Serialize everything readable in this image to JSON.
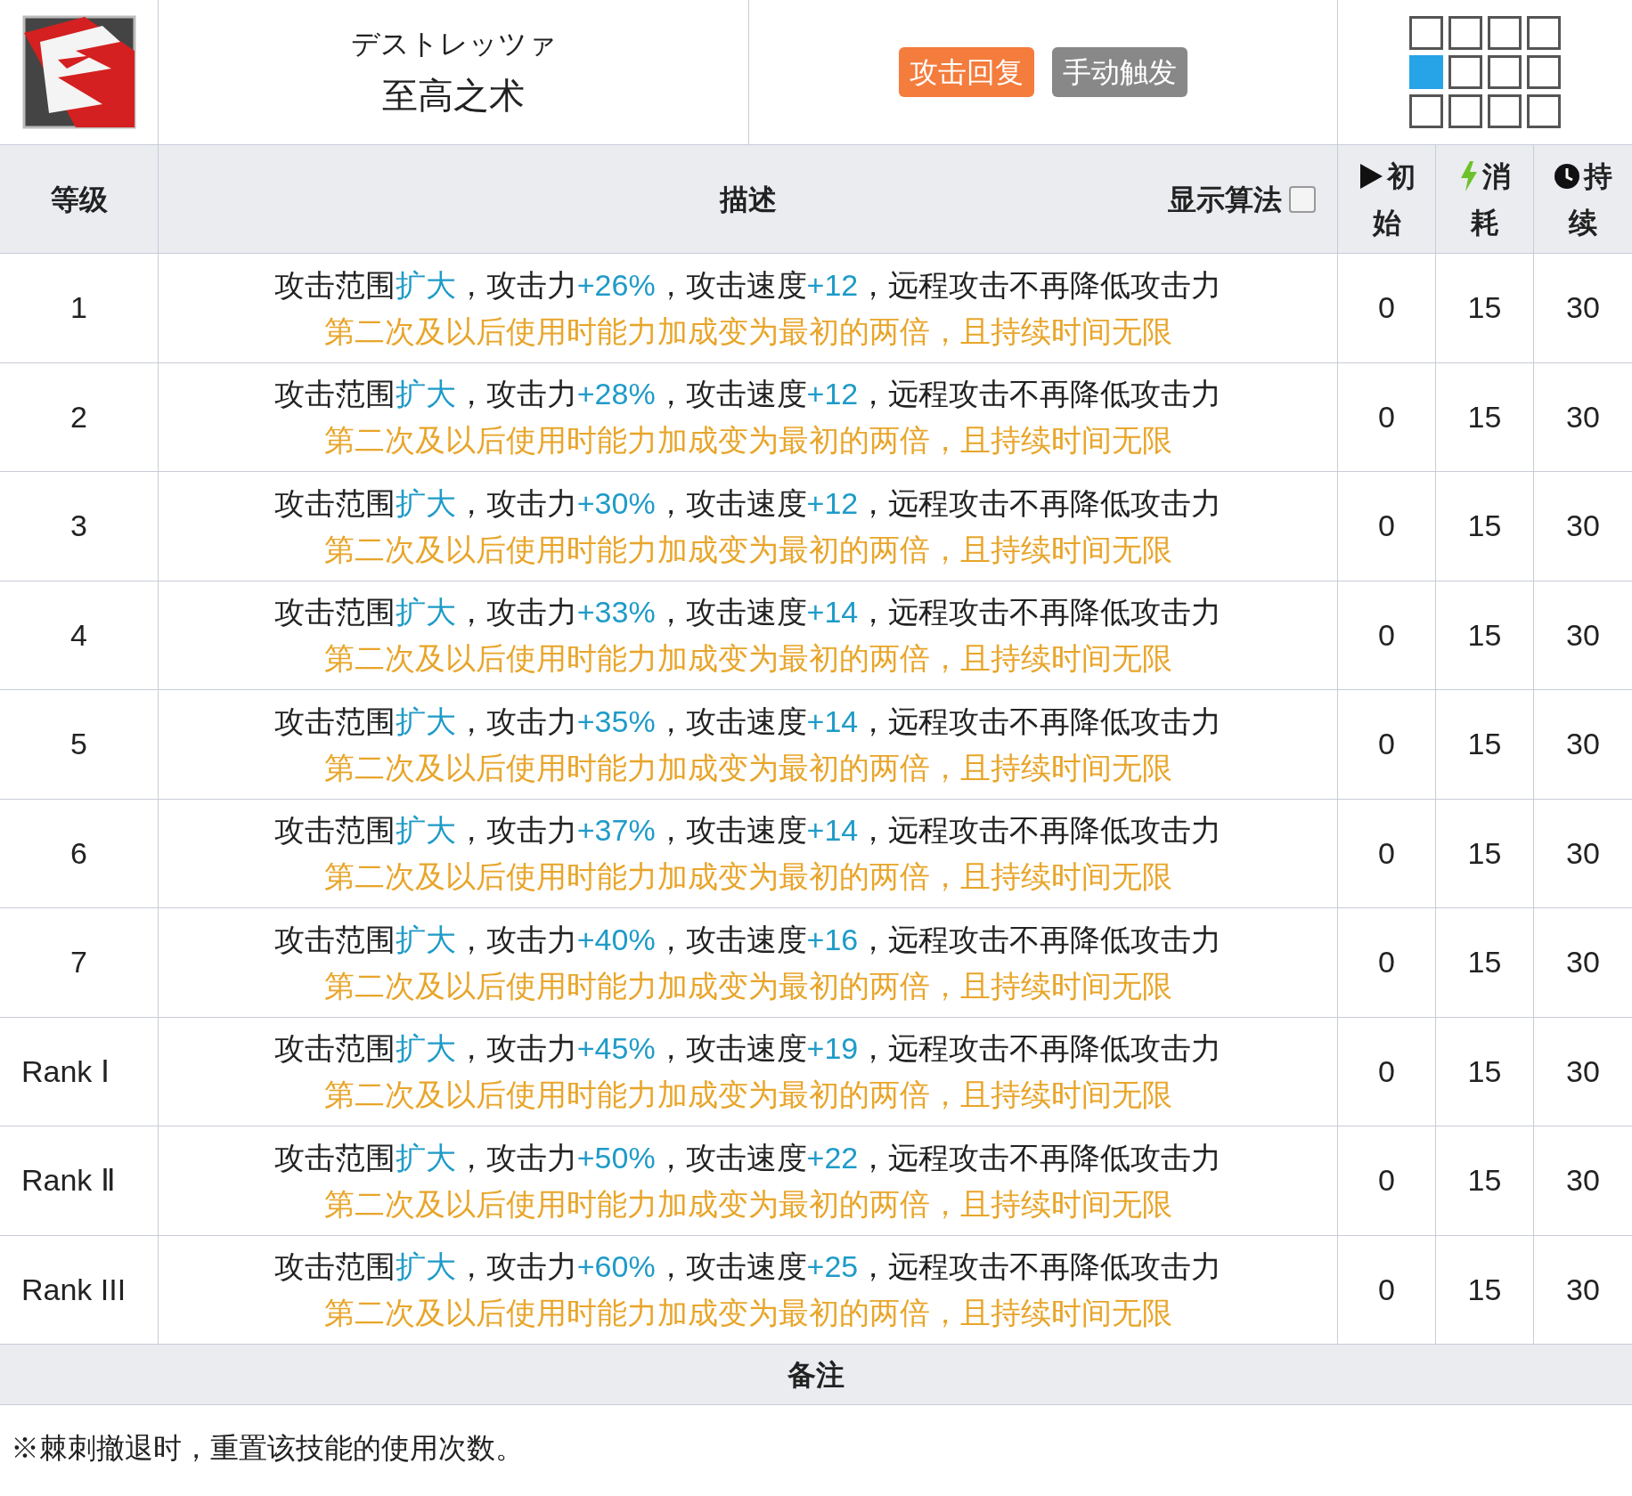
{
  "skill": {
    "name_jp": "デストレッツァ",
    "name": "至高之术",
    "tags": [
      {
        "label": "攻击回复",
        "kind": "recovery"
      },
      {
        "label": "手动触发",
        "kind": "trigger"
      }
    ],
    "range": [
      [
        {
          "selected": false
        },
        {
          "selected": false
        },
        {
          "selected": false
        },
        {
          "selected": false
        }
      ],
      [
        {
          "selected": true
        },
        {
          "selected": false
        },
        {
          "selected": false
        },
        {
          "selected": false
        }
      ],
      [
        {
          "selected": false
        },
        {
          "selected": false
        },
        {
          "selected": false
        },
        {
          "selected": false
        }
      ]
    ]
  },
  "table": {
    "columns": [
      {
        "label": "等级",
        "kind": "level"
      },
      {
        "label": "描述",
        "kind": "desc"
      },
      {
        "label": "初始",
        "kind": "initial"
      },
      {
        "label": "消耗",
        "kind": "cost"
      },
      {
        "label": "持续",
        "kind": "duration"
      }
    ],
    "show_formula": {
      "label": "显示算法",
      "checked": false
    },
    "rows": [
      {
        "level": "1",
        "line1": [
          {
            "text": "攻击范围",
            "highlight": false
          },
          {
            "text": "扩大",
            "highlight": true
          },
          {
            "text": "，攻击力",
            "highlight": false
          },
          {
            "text": "+26%",
            "highlight": true
          },
          {
            "text": "，攻击速度",
            "highlight": false
          },
          {
            "text": "+12",
            "highlight": true
          },
          {
            "text": "，远程攻击不再降低攻击力",
            "highlight": false
          }
        ],
        "line2": "第二次及以后使用时能力加成变为最初的两倍，且持续时间无限",
        "initial": "0",
        "cost": "15",
        "duration": "30"
      },
      {
        "level": "2",
        "line1": [
          {
            "text": "攻击范围",
            "highlight": false
          },
          {
            "text": "扩大",
            "highlight": true
          },
          {
            "text": "，攻击力",
            "highlight": false
          },
          {
            "text": "+28%",
            "highlight": true
          },
          {
            "text": "，攻击速度",
            "highlight": false
          },
          {
            "text": "+12",
            "highlight": true
          },
          {
            "text": "，远程攻击不再降低攻击力",
            "highlight": false
          }
        ],
        "line2": "第二次及以后使用时能力加成变为最初的两倍，且持续时间无限",
        "initial": "0",
        "cost": "15",
        "duration": "30"
      },
      {
        "level": "3",
        "line1": [
          {
            "text": "攻击范围",
            "highlight": false
          },
          {
            "text": "扩大",
            "highlight": true
          },
          {
            "text": "，攻击力",
            "highlight": false
          },
          {
            "text": "+30%",
            "highlight": true
          },
          {
            "text": "，攻击速度",
            "highlight": false
          },
          {
            "text": "+12",
            "highlight": true
          },
          {
            "text": "，远程攻击不再降低攻击力",
            "highlight": false
          }
        ],
        "line2": "第二次及以后使用时能力加成变为最初的两倍，且持续时间无限",
        "initial": "0",
        "cost": "15",
        "duration": "30"
      },
      {
        "level": "4",
        "line1": [
          {
            "text": "攻击范围",
            "highlight": false
          },
          {
            "text": "扩大",
            "highlight": true
          },
          {
            "text": "，攻击力",
            "highlight": false
          },
          {
            "text": "+33%",
            "highlight": true
          },
          {
            "text": "，攻击速度",
            "highlight": false
          },
          {
            "text": "+14",
            "highlight": true
          },
          {
            "text": "，远程攻击不再降低攻击力",
            "highlight": false
          }
        ],
        "line2": "第二次及以后使用时能力加成变为最初的两倍，且持续时间无限",
        "initial": "0",
        "cost": "15",
        "duration": "30"
      },
      {
        "level": "5",
        "line1": [
          {
            "text": "攻击范围",
            "highlight": false
          },
          {
            "text": "扩大",
            "highlight": true
          },
          {
            "text": "，攻击力",
            "highlight": false
          },
          {
            "text": "+35%",
            "highlight": true
          },
          {
            "text": "，攻击速度",
            "highlight": false
          },
          {
            "text": "+14",
            "highlight": true
          },
          {
            "text": "，远程攻击不再降低攻击力",
            "highlight": false
          }
        ],
        "line2": "第二次及以后使用时能力加成变为最初的两倍，且持续时间无限",
        "initial": "0",
        "cost": "15",
        "duration": "30"
      },
      {
        "level": "6",
        "line1": [
          {
            "text": "攻击范围",
            "highlight": false
          },
          {
            "text": "扩大",
            "highlight": true
          },
          {
            "text": "，攻击力",
            "highlight": false
          },
          {
            "text": "+37%",
            "highlight": true
          },
          {
            "text": "，攻击速度",
            "highlight": false
          },
          {
            "text": "+14",
            "highlight": true
          },
          {
            "text": "，远程攻击不再降低攻击力",
            "highlight": false
          }
        ],
        "line2": "第二次及以后使用时能力加成变为最初的两倍，且持续时间无限",
        "initial": "0",
        "cost": "15",
        "duration": "30"
      },
      {
        "level": "7",
        "line1": [
          {
            "text": "攻击范围",
            "highlight": false
          },
          {
            "text": "扩大",
            "highlight": true
          },
          {
            "text": "，攻击力",
            "highlight": false
          },
          {
            "text": "+40%",
            "highlight": true
          },
          {
            "text": "，攻击速度",
            "highlight": false
          },
          {
            "text": "+16",
            "highlight": true
          },
          {
            "text": "，远程攻击不再降低攻击力",
            "highlight": false
          }
        ],
        "line2": "第二次及以后使用时能力加成变为最初的两倍，且持续时间无限",
        "initial": "0",
        "cost": "15",
        "duration": "30"
      },
      {
        "level": "Rank Ⅰ",
        "line1": [
          {
            "text": "攻击范围",
            "highlight": false
          },
          {
            "text": "扩大",
            "highlight": true
          },
          {
            "text": "，攻击力",
            "highlight": false
          },
          {
            "text": "+45%",
            "highlight": true
          },
          {
            "text": "，攻击速度",
            "highlight": false
          },
          {
            "text": "+19",
            "highlight": true
          },
          {
            "text": "，远程攻击不再降低攻击力",
            "highlight": false
          }
        ],
        "line2": "第二次及以后使用时能力加成变为最初的两倍，且持续时间无限",
        "initial": "0",
        "cost": "15",
        "duration": "30"
      },
      {
        "level": "Rank Ⅱ",
        "line1": [
          {
            "text": "攻击范围",
            "highlight": false
          },
          {
            "text": "扩大",
            "highlight": true
          },
          {
            "text": "，攻击力",
            "highlight": false
          },
          {
            "text": "+50%",
            "highlight": true
          },
          {
            "text": "，攻击速度",
            "highlight": false
          },
          {
            "text": "+22",
            "highlight": true
          },
          {
            "text": "，远程攻击不再降低攻击力",
            "highlight": false
          }
        ],
        "line2": "第二次及以后使用时能力加成变为最初的两倍，且持续时间无限",
        "initial": "0",
        "cost": "15",
        "duration": "30"
      },
      {
        "level": "Rank III",
        "line1": [
          {
            "text": "攻击范围",
            "highlight": false
          },
          {
            "text": "扩大",
            "highlight": true
          },
          {
            "text": "，攻击力",
            "highlight": false
          },
          {
            "text": "+60%",
            "highlight": true
          },
          {
            "text": "，攻击速度",
            "highlight": false
          },
          {
            "text": "+25",
            "highlight": true
          },
          {
            "text": "，远程攻击不再降低攻击力",
            "highlight": false
          }
        ],
        "line2": "第二次及以后使用时能力加成变为最初的两倍，且持续时间无限",
        "initial": "0",
        "cost": "15",
        "duration": "30"
      }
    ]
  },
  "notes": {
    "title": "备注",
    "text": "※棘刺撤退时，重置该技能的使用次数。"
  }
}
